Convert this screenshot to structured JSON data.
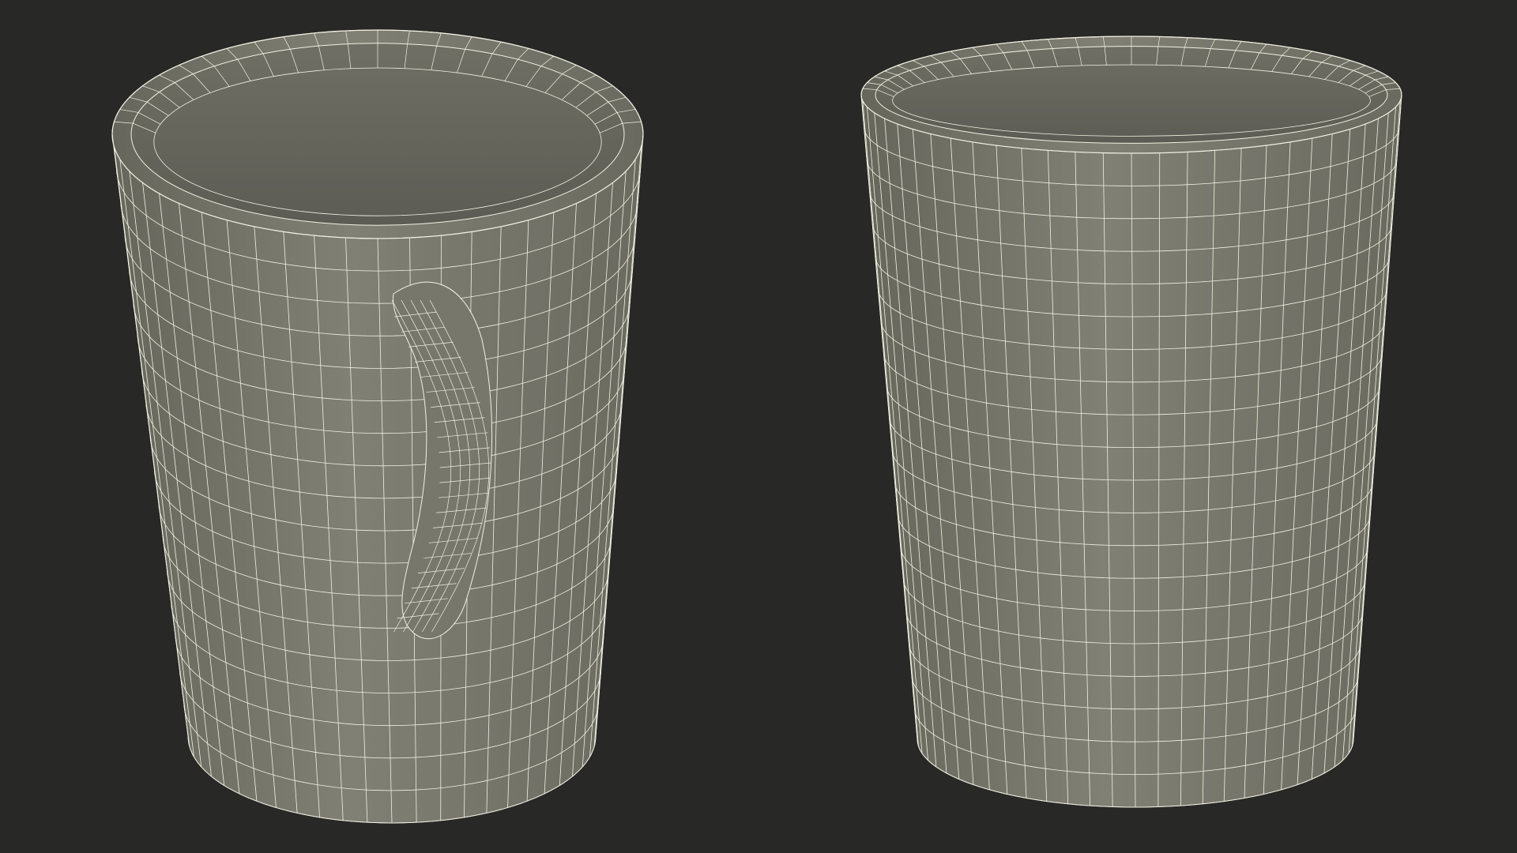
{
  "scene": {
    "background_color": "#282826",
    "mesh_fill_color": "#7b7b70",
    "mesh_shadow_color": "#5e5e55",
    "mesh_highlight_color": "#8a8a7e",
    "wire_color": "#f1f0e2",
    "objects": [
      {
        "name": "mug-with-handle",
        "view": "back",
        "has_handle": true
      },
      {
        "name": "mug-without-handle",
        "view": "front",
        "has_handle": false
      }
    ]
  }
}
